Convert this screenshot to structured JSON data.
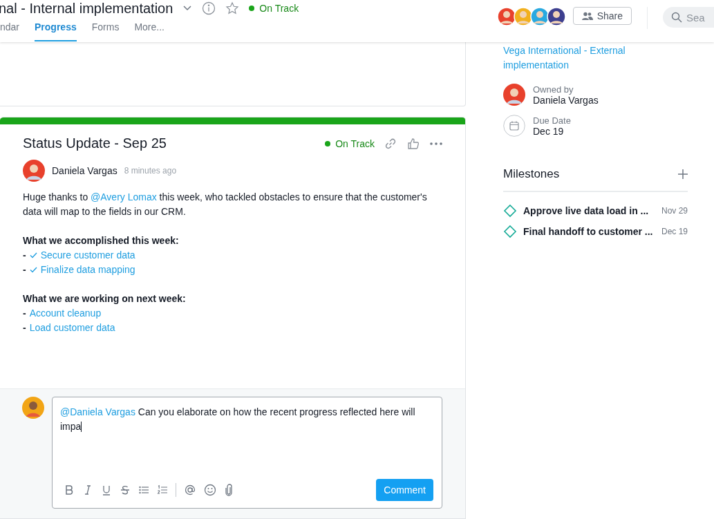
{
  "header": {
    "title": "nal - Internal implementation",
    "status": {
      "label": "On Track",
      "color": "#1aa51a"
    },
    "starred": false,
    "tabs": [
      {
        "label": "ndar",
        "selected": false
      },
      {
        "label": "Progress",
        "selected": true
      },
      {
        "label": "Forms",
        "selected": false
      },
      {
        "label": "More...",
        "selected": false
      }
    ],
    "members": [
      {
        "color": "#e8412c"
      },
      {
        "color": "#f2b01e"
      },
      {
        "color": "#29a9e0"
      },
      {
        "color": "#3d3f8f"
      }
    ],
    "share_label": "Share",
    "search": {
      "placeholder": "Sea"
    }
  },
  "update": {
    "title": "Status Update - Sep 25",
    "status": {
      "label": "On Track",
      "color": "#1aa51a"
    },
    "author": {
      "name": "Daniela Vargas",
      "time": "8 minutes ago"
    },
    "intro": [
      {
        "kind": "text",
        "text": "Huge thanks to "
      },
      {
        "kind": "mention",
        "text": "@Avery Lomax"
      },
      {
        "kind": "text",
        "text": " this week, who tackled obstacles to ensure that the customer's data will map to the fields in our CRM."
      }
    ],
    "sections": [
      {
        "heading": "What we accomplished this week:",
        "items": [
          {
            "marker": "-",
            "done": true,
            "label": "Secure customer data"
          },
          {
            "marker": "-",
            "done": true,
            "label": "Finalize data mapping"
          }
        ]
      },
      {
        "heading": "What we are working on next week:",
        "items": [
          {
            "marker": "-",
            "done": false,
            "label": "Account cleanup"
          },
          {
            "marker": "-",
            "done": false,
            "label": "Load customer data"
          }
        ]
      }
    ]
  },
  "comment": {
    "value": [
      {
        "kind": "mention",
        "text": "@Daniela Vargas"
      },
      {
        "kind": "text",
        "text": " Can you elaborate on how the recent progress reflected here will impa"
      }
    ],
    "button": "Comment"
  },
  "sidebar": {
    "related": "Vega International - External implementation",
    "owner": {
      "label": "Owned by",
      "name": "Daniela Vargas"
    },
    "due": {
      "label": "Due Date",
      "value": "Dec 19"
    },
    "milestones_title": "Milestones",
    "milestones": [
      {
        "name": "Approve live data load in ...",
        "date": "Nov 29"
      },
      {
        "name": "Final handoff to customer ...",
        "date": "Dec 19"
      }
    ]
  }
}
